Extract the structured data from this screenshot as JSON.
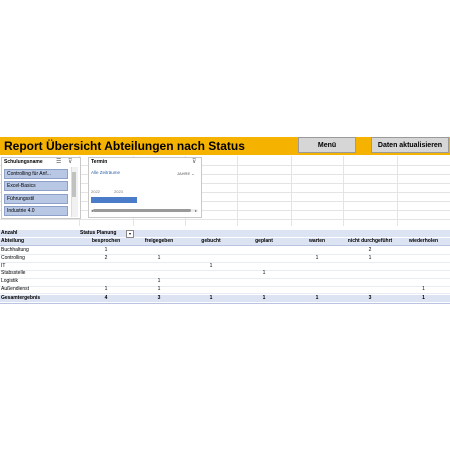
{
  "header": {
    "title": "Report Übersicht Abteilungen nach Status",
    "menu_button": "Menü",
    "refresh_button": "Daten aktualisieren"
  },
  "slicer": {
    "title": "Schulungsname",
    "items": [
      "Controlling für Anf...",
      "Excel-Basics",
      "Führungsstil",
      "Industrie 4.0"
    ]
  },
  "timeline": {
    "title": "Termin",
    "range_label": "Alle Zeiträume",
    "level_label": "JAHRE",
    "years": [
      "2022",
      "2023"
    ]
  },
  "pivot": {
    "corner_label": "Anzahl",
    "column_field": "Status Planung",
    "row_field": "Abteilung",
    "columns": [
      "besprochen",
      "freigegeben",
      "gebucht",
      "geplant",
      "warten",
      "nicht durchgeführt",
      "wiederholen"
    ],
    "rows": [
      {
        "label": "Buchhaltung",
        "values": [
          "1",
          "",
          "",
          "",
          "",
          "2",
          ""
        ]
      },
      {
        "label": "Controlling",
        "values": [
          "2",
          "1",
          "",
          "",
          "1",
          "1",
          ""
        ]
      },
      {
        "label": "IT",
        "values": [
          "",
          "",
          "1",
          "",
          "",
          "",
          ""
        ]
      },
      {
        "label": "Stabsstelle",
        "values": [
          "",
          "",
          "",
          "1",
          "",
          "",
          ""
        ]
      },
      {
        "label": "Logistik",
        "values": [
          "",
          "1",
          "",
          "",
          "",
          "",
          ""
        ]
      },
      {
        "label": "Außendienst",
        "values": [
          "1",
          "1",
          "",
          "",
          "",
          "",
          "1"
        ]
      }
    ],
    "total": {
      "label": "Gesamtergebnis",
      "values": [
        "4",
        "3",
        "1",
        "1",
        "1",
        "3",
        "1"
      ]
    }
  }
}
